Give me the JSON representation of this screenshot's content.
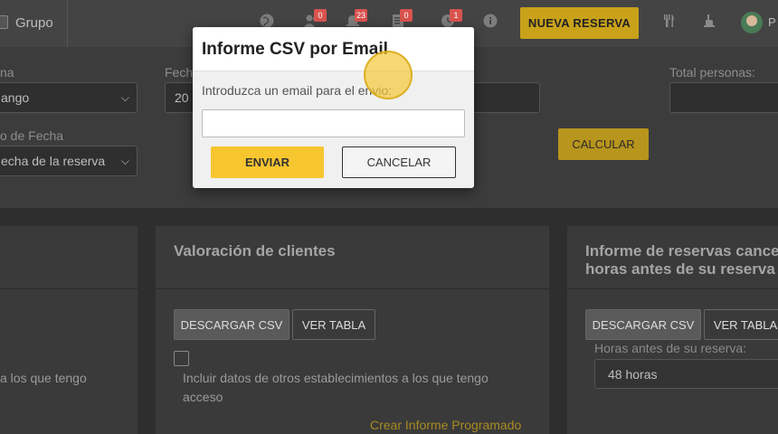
{
  "topbar": {
    "group_label": "Grupo",
    "badges": {
      "users": "0",
      "notifications": "23",
      "tasks": "0",
      "clock": "1"
    },
    "new_booking_label": "NUEVA RESERVA",
    "user_initial": "P"
  },
  "filters": {
    "range_label": "na",
    "range_value": "ango",
    "date_label": "Fecha",
    "date_value": "20",
    "datetype_label": "o de Fecha",
    "datetype_value": "echa de la reserva",
    "calculate_label": "CALCULAR",
    "total_people_label": "Total personas:"
  },
  "cards": {
    "left": {
      "text": "a los que tengo"
    },
    "valoracion": {
      "title": "Valoración de clientes",
      "download_label": "DESCARGAR CSV",
      "table_label": "VER TABLA",
      "include_text": "Incluir datos de otros establecimientos a los que tengo acceso",
      "scheduled_link": "Crear Informe Programado"
    },
    "cancel": {
      "title": "Informe de reservas cance horas antes de su reserva",
      "download_label": "DESCARGAR CSV",
      "table_label": "VER TABLA",
      "hours_label": "Horas antes de su reserva:",
      "hours_value": "48 horas"
    }
  },
  "modal": {
    "title": "Informe CSV por Email",
    "prompt": "Introduzca un email para el envio:",
    "email_value": "",
    "send_label": "ENVIAR",
    "cancel_label": "CANCELAR"
  }
}
